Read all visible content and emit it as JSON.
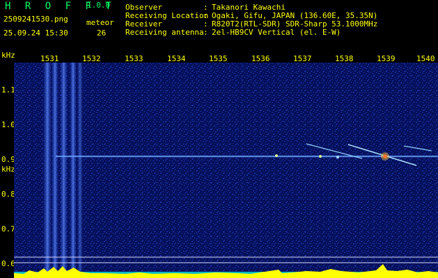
{
  "header": {
    "app_title": "H R O F F T",
    "version": "1.0.0",
    "file_name": "2509241530.png",
    "timestamp": "25.09.24 15:30",
    "meteor_label": "meteor",
    "meteor_count": "26"
  },
  "station_info": [
    {
      "label": "Observer",
      "value": "Takanori Kawachi"
    },
    {
      "label": "Receiving Location",
      "value": "Ogaki, Gifu, JAPAN (136.60E, 35.35N)"
    },
    {
      "label": "Receiver",
      "value": "R820T2(RTL-SDR) SDR-Sharp 53.1000MHz"
    },
    {
      "label": "Receiving antenna",
      "value": "2el-HB9CV Vertical (el. E-W)"
    }
  ],
  "axes": {
    "x_unit": "kHz",
    "y_unit": "kHz",
    "x_ticks": [
      "1531",
      "1532",
      "1533",
      "1534",
      "1535",
      "1536",
      "1537",
      "1538",
      "1539",
      "1540"
    ],
    "y_ticks": [
      "1.1",
      "1.0",
      "0.9",
      "0.8",
      "0.7",
      "0.6"
    ]
  },
  "colors": {
    "background": "#000000",
    "noise_floor": "#0a1a78",
    "signal": "#66aaff",
    "label_yellow": "#ffff00",
    "label_green": "#00ff66",
    "spectrum_trace": "#ffff00",
    "spectrum_fill": "#00cccc"
  }
}
